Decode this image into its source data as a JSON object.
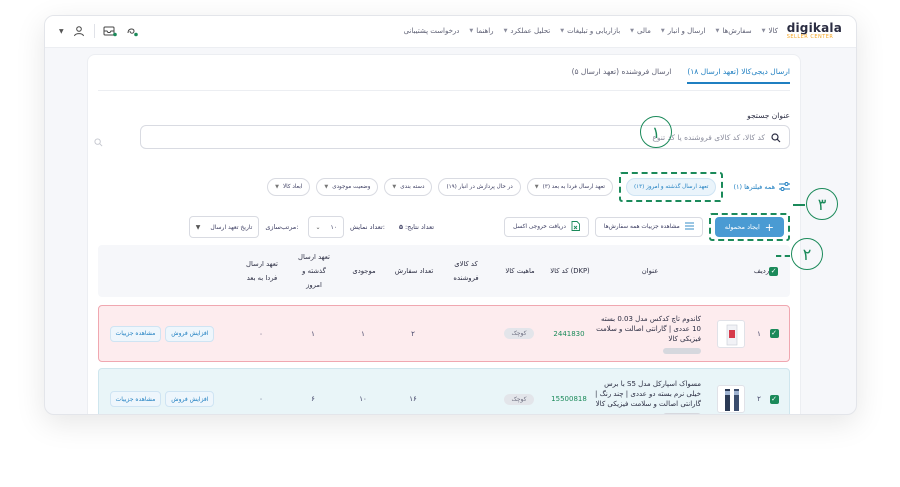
{
  "header": {
    "logo": "digikala",
    "logo_sub": "SELLER CENTER",
    "nav": [
      "کالا",
      "سفارش‌ها",
      "ارسال و انبار",
      "مالی",
      "بازاریابی و تبلیغات",
      "تحلیل عملکرد",
      "راهنما",
      "درخواست پشتیبانی"
    ]
  },
  "tabs": [
    "ارسال دیجی‌کالا (تعهد ارسال ۱۸)",
    "ارسال فروشنده (تعهد ارسال ۵)"
  ],
  "search": {
    "label": "عنوان جستجو",
    "placeholder": "کد کالا، کد کالای فروشنده یا کد تنوع"
  },
  "filters": {
    "all": "همه فیلترها (۱)",
    "chips": [
      "تعهد ارسال گذشته و امروز (۱۳)",
      "تعهد ارسال فردا به بعد (۳)",
      "در حال پردازش در انبار (۱۹)",
      "دسته بندی",
      "وضعیت موجودی",
      "ابعاد کالا"
    ]
  },
  "actions": {
    "create": "ایجاد محموله",
    "details_all": "مشاهده جزییات همه سفارش‌ها",
    "excel": "دریافت خروجی اکسل",
    "results_label": "تعداد نتایج:",
    "results_count": "۵",
    "show_label": "تعداد نمایش:",
    "show_value": "۱۰",
    "sort_label": "مرتب‌سازی:",
    "sort_value": "تاریخ تعهد ارسال"
  },
  "table": {
    "headers": [
      "ردیف",
      "عنوان",
      "کد کالا (DKP)",
      "ماهیت کالا",
      "کد کالای فروشنده",
      "تعداد سفارش",
      "موجودی",
      "تعهد ارسال گذشته و امروز",
      "تعهد ارسال فردا به بعد"
    ],
    "rows": [
      {
        "index": "۱",
        "title": "کاندوم تاچ کدکس مدل 0.03 بسته 10 عددی | گارانتی اصالت و سلامت فیزیکی کالا",
        "dkp": "2441830",
        "nature": "کوچک",
        "seller_code": "",
        "orders": "۲",
        "stock": "۱",
        "past_today": "۱",
        "tomorrow": "۰",
        "increase": "افزایش فروش",
        "details": "مشاهده جزییات"
      },
      {
        "index": "۲",
        "title": "مسواک اسپارکل مدل S5 با برس خیلی نرم بسته دو عددی | چند رنگ | گارانتی اصالت و سلامت فیزیکی کالا",
        "dkp": "15500818",
        "nature": "کوچک",
        "seller_code": "",
        "orders": "۱۶",
        "stock": "۱۰",
        "past_today": "۶",
        "tomorrow": "۰",
        "increase": "افزایش فروش",
        "details": "مشاهده جزییات"
      }
    ]
  },
  "annotations": [
    "۱",
    "۲",
    "۳"
  ],
  "colors": {
    "accent": "#1f7fc1",
    "primary_button": "#4a9bd3",
    "annotation": "#1b8a5a",
    "row_highlight": "#fdecee"
  }
}
